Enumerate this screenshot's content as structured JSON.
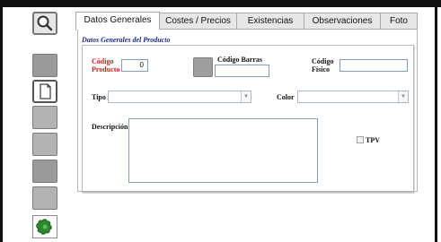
{
  "tabs": [
    {
      "label": "Datos Generales",
      "active": true
    },
    {
      "label": "Costes / Precios",
      "active": false
    },
    {
      "label": "Existencias",
      "active": false
    },
    {
      "label": "Observaciones",
      "active": false
    },
    {
      "label": "Foto",
      "active": false
    }
  ],
  "section_title": "Datos Generales del Producto",
  "fields": {
    "codigo_producto": {
      "label_line1": "Código",
      "label_line2": "Producto",
      "value": "0"
    },
    "codigo_barras": {
      "label": "Código Barras",
      "value": ""
    },
    "codigo_fisico": {
      "label_line1": "Código",
      "label_line2": "Físico",
      "value": ""
    },
    "tipo": {
      "label": "Tipo",
      "value": ""
    },
    "color": {
      "label": "Color",
      "value": ""
    },
    "descripcion": {
      "label": "Descripción",
      "value": ""
    },
    "tpv": {
      "label": "TPV",
      "checked": false
    }
  },
  "toolbar": [
    {
      "icon": "search-icon"
    },
    {
      "icon": "disabled-icon"
    },
    {
      "icon": "new-document-icon"
    },
    {
      "icon": "disabled-icon"
    },
    {
      "icon": "disabled-icon"
    },
    {
      "icon": "disabled-icon"
    },
    {
      "icon": "disabled-icon"
    },
    {
      "icon": "puzzle-icon"
    }
  ],
  "colors": {
    "required_label": "#cc1b1b",
    "section_title": "#1c2a8c",
    "frame": "#111111"
  }
}
